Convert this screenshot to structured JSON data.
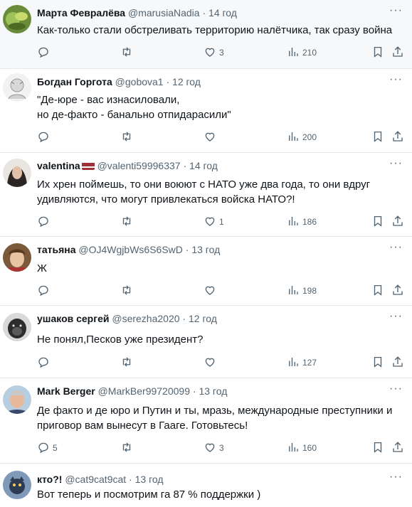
{
  "tweets": [
    {
      "name": "Марта Февралёва",
      "handle": "@marusiaNadia",
      "dot": "·",
      "time": "14 год",
      "text": "Как-только стали обстреливать территорию налётчика, так сразу война",
      "replies": "",
      "retweets": "",
      "likes": "3",
      "views": "210"
    },
    {
      "name": "Богдан Горгота",
      "handle": "@gobova1",
      "dot": "·",
      "time": "12 год",
      "text": "\"Де-юре - вас изнасиловали,\nно де-факто - банально отпидарасили\"",
      "replies": "",
      "retweets": "",
      "likes": "",
      "views": "200"
    },
    {
      "name": "valentina",
      "handle": "@valenti59996337",
      "dot": "·",
      "time": "14 год",
      "text": "Их хрен поймешь, то они воюют с НАТО уже два года, то они вдруг\nудивляются, что могут привлекаться войска НАТО?!",
      "replies": "",
      "retweets": "",
      "likes": "1",
      "views": "186"
    },
    {
      "name": "татьяна",
      "handle": "@OJ4WgjbWs6S6SwD",
      "dot": "·",
      "time": "13 год",
      "text": "Ж",
      "replies": "",
      "retweets": "",
      "likes": "",
      "views": "198"
    },
    {
      "name": "ушаков сергей",
      "handle": "@serezha2020",
      "dot": "·",
      "time": "12 год",
      "text": "Не понял,Песков уже президент?",
      "replies": "",
      "retweets": "",
      "likes": "",
      "views": "127"
    },
    {
      "name": "Mark Berger",
      "handle": "@MarkBer99720099",
      "dot": "·",
      "time": "13 год",
      "text": "Де факто и де юро и  Путин  и ты, мразь,  международные  преступники и\nприговор вам вынесут в Гааге. Готовьтесь!",
      "replies": "5",
      "retweets": "",
      "likes": "3",
      "views": "160"
    },
    {
      "name": "кто?!",
      "handle": "@cat9cat9cat",
      "dot": "·",
      "time": "13 год",
      "text": "Вот теперь и посмотрим га 87 % поддержки )",
      "replies": "",
      "retweets": "",
      "likes": "",
      "views": ""
    }
  ],
  "icons": {
    "reply": "reply-icon",
    "retweet": "retweet-icon",
    "like": "heart-icon",
    "views": "views-bar-chart-icon",
    "bookmark": "bookmark-icon",
    "share": "share-icon",
    "more": "more-dots-icon"
  },
  "colors": {
    "muted": "#536471",
    "text": "#0f1419",
    "divider": "#e6e9ec",
    "highlight_bg": "#f7f8f9"
  }
}
